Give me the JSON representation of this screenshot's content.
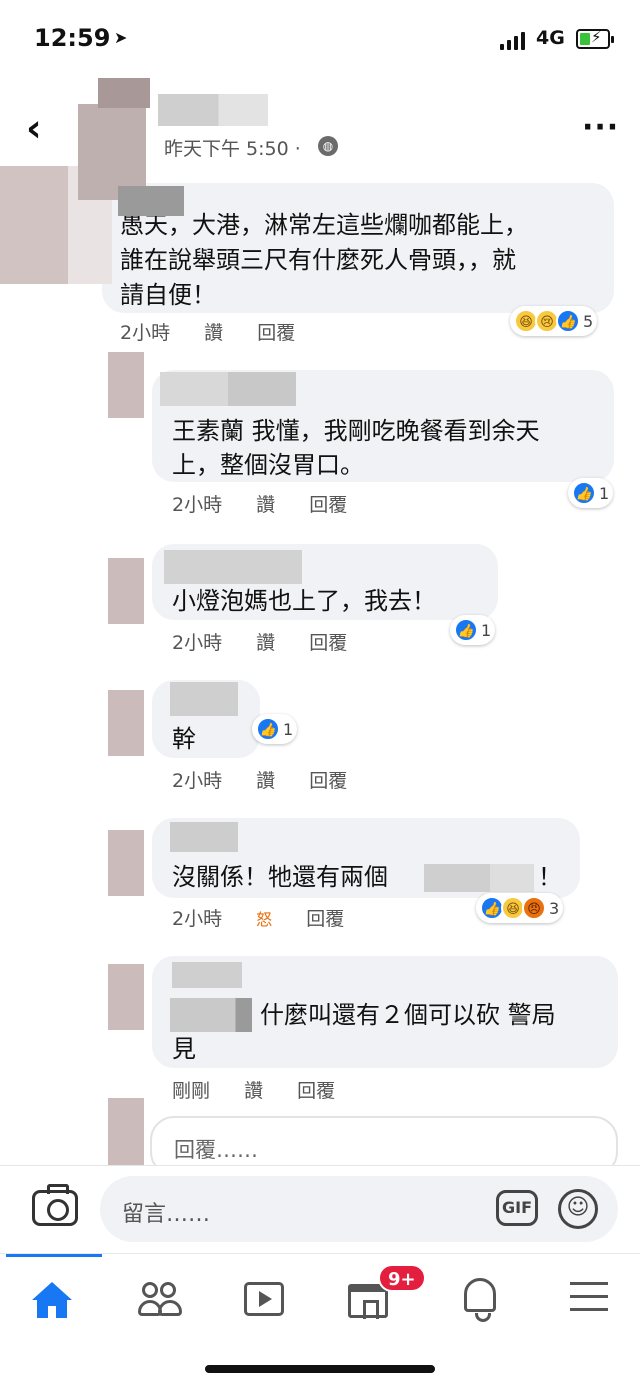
{
  "status_bar": {
    "time": "12:59",
    "network": "4G"
  },
  "header": {
    "post_time": "昨天下午 5:50 ·",
    "back_icon": "chevron-left-icon",
    "more_icon": "more-dots-icon"
  },
  "comments": [
    {
      "text_lines": [
        "愚天，大港，淋常左這些爛咖都能上，",
        "誰在說舉頭三尺有什麼死人骨頭，，就",
        "請自便！"
      ],
      "time": "2小時",
      "read": "讚",
      "reply": "回覆",
      "reactions": [
        "haha",
        "sad",
        "like"
      ],
      "reaction_count": "5"
    },
    {
      "text_lines": [
        "王素蘭 我懂，我剛吃晚餐看到余天",
        "上，整個沒胃口。"
      ],
      "time": "2小時",
      "read": "讚",
      "reply": "回覆",
      "reactions": [
        "like"
      ],
      "reaction_count": "1"
    },
    {
      "text_lines": [
        "小燈泡媽也上了，我去！"
      ],
      "time": "2小時",
      "read": "讚",
      "reply": "回覆",
      "reactions": [
        "like"
      ],
      "reaction_count": "1"
    },
    {
      "text_lines": [
        "幹"
      ],
      "time": "2小時",
      "read": "讚",
      "reply": "回覆",
      "reactions": [
        "like"
      ],
      "reaction_count": "1"
    },
    {
      "text_lines": [
        "沒關係！牠還有兩個",
        "！"
      ],
      "time": "2小時",
      "read": "怒",
      "reply": "回覆",
      "reactions": [
        "like",
        "haha",
        "angry"
      ],
      "reaction_count": "3"
    },
    {
      "text_lines": [
        "什麼叫還有２個可以砍 警局",
        "見"
      ],
      "time": "剛剛",
      "read": "讚",
      "reply": "回覆"
    }
  ],
  "reply_box": {
    "placeholder": "回覆……"
  },
  "composer": {
    "placeholder": "留言……",
    "gif_label": "GIF",
    "camera_icon": "camera-icon",
    "emoji_icon": "emoji-icon"
  },
  "bottom_nav": {
    "items": [
      "home-icon",
      "friends-icon",
      "video-icon",
      "marketplace-icon",
      "notifications-icon",
      "menu-icon"
    ],
    "marketplace_badge": "9+",
    "accent": "#1877f2",
    "badge_color": "#e41e3f"
  }
}
